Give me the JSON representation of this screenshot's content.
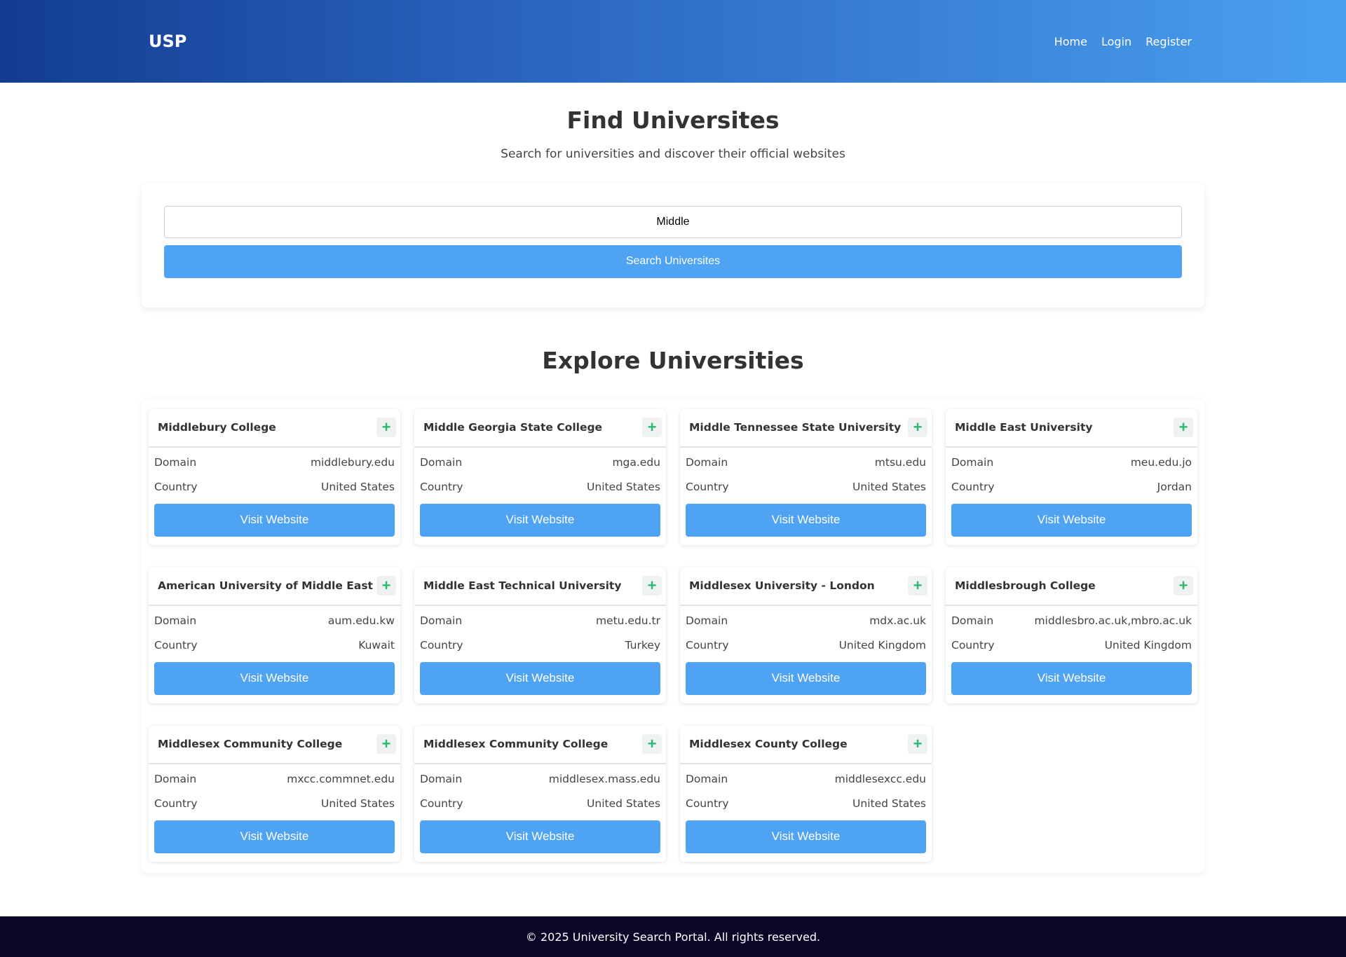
{
  "header": {
    "logo": "USP",
    "nav": [
      {
        "label": "Home"
      },
      {
        "label": "Login"
      },
      {
        "label": "Register"
      }
    ]
  },
  "hero": {
    "title": "Find Universites",
    "subtitle": "Search for universities and discover their official websites"
  },
  "search": {
    "value": "Middle",
    "button_label": "Search Universites"
  },
  "explore": {
    "title": "Explore Universities",
    "domain_label": "Domain",
    "country_label": "Country",
    "visit_label": "Visit Website",
    "add_icon": "+",
    "results": [
      {
        "name": "Middlebury College",
        "domain": "middlebury.edu",
        "country": "United States"
      },
      {
        "name": "Middle Georgia State College",
        "domain": "mga.edu",
        "country": "United States"
      },
      {
        "name": "Middle Tennessee State University",
        "domain": "mtsu.edu",
        "country": "United States"
      },
      {
        "name": "Middle East University",
        "domain": "meu.edu.jo",
        "country": "Jordan"
      },
      {
        "name": "American University of Middle East",
        "domain": "aum.edu.kw",
        "country": "Kuwait"
      },
      {
        "name": "Middle East Technical University",
        "domain": "metu.edu.tr",
        "country": "Turkey"
      },
      {
        "name": "Middlesex University - London",
        "domain": "mdx.ac.uk",
        "country": "United Kingdom"
      },
      {
        "name": "Middlesbrough College",
        "domain": "middlesbro.ac.uk,mbro.ac.uk",
        "country": "United Kingdom"
      },
      {
        "name": "Middlesex Community College",
        "domain": "mxcc.commnet.edu",
        "country": "United States"
      },
      {
        "name": "Middlesex Community College",
        "domain": "middlesex.mass.edu",
        "country": "United States"
      },
      {
        "name": "Middlesex County College",
        "domain": "middlesexcc.edu",
        "country": "United States"
      }
    ]
  },
  "footer": {
    "text": "© 2025 University Search Portal. All rights reserved."
  },
  "colors": {
    "accent": "#4fa3f3",
    "header_start": "#123c91",
    "header_end": "#4aa0ef",
    "footer_bg": "#0b0628",
    "add_icon": "#2fb96f"
  }
}
